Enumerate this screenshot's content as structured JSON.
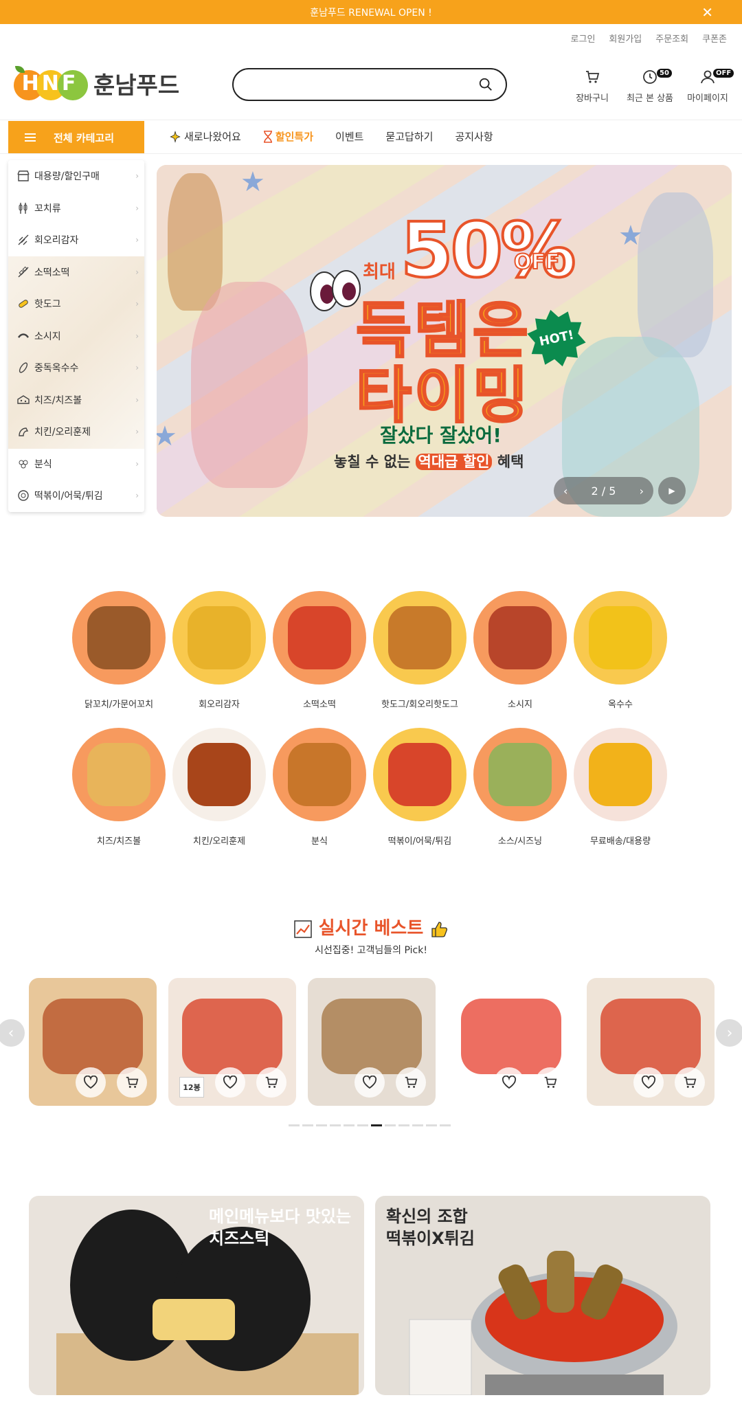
{
  "topbar": {
    "notice": "훈남푸드 RENEWAL OPEN !",
    "close": "✕"
  },
  "util": [
    "로그인",
    "회원가입",
    "주문조회",
    "쿠폰존"
  ],
  "logo": {
    "letters": "HNF",
    "brand": "훈남푸드"
  },
  "search": {
    "value": "",
    "placeholder": ""
  },
  "header_icons": [
    {
      "label": "장바구니",
      "icon": "cart-icon"
    },
    {
      "label": "최근 본 상품",
      "icon": "clock-icon",
      "badge": "50"
    },
    {
      "label": "마이페이지",
      "icon": "user-icon",
      "badge": "OFF"
    }
  ],
  "category_button": "전체 카테고리",
  "gnb": [
    "새로나왔어요",
    "할인특가",
    "이벤트",
    "묻고답하기",
    "공지사항"
  ],
  "category_menu": [
    "대용량/할인구매",
    "꼬치류",
    "회오리감자",
    "소떡소떡",
    "핫도그",
    "소시지",
    "중독옥수수",
    "치즈/치즈볼",
    "치킨/오리훈제",
    "분식",
    "떡볶이/어묵/튀김"
  ],
  "banner": {
    "max": "최대",
    "percent": "50%",
    "off": "OFF",
    "line1": "득템은",
    "line2": "타이밍",
    "hot": "HOT!",
    "sub1": "잘샀다 잘샀어!",
    "sub2_pre": "놓칠 수 없는",
    "sub2_mid": "역대급 할인",
    "sub2_post": "혜택",
    "page": "2 / 5"
  },
  "categories": [
    {
      "name": "닭꼬치/가문어꼬치",
      "bg": "#f79a5e",
      "food": "#9a5a2a"
    },
    {
      "name": "회오리감자",
      "bg": "#f9c94e",
      "food": "#e8b22a"
    },
    {
      "name": "소떡소떡",
      "bg": "#f79a5e",
      "food": "#d8452a"
    },
    {
      "name": "핫도그/회오리핫도그",
      "bg": "#f9c94e",
      "food": "#c87a2a"
    },
    {
      "name": "소시지",
      "bg": "#f79a5e",
      "food": "#b8452a"
    },
    {
      "name": "옥수수",
      "bg": "#f9c94e",
      "food": "#f2c21a"
    },
    {
      "name": "치즈/치즈볼",
      "bg": "#f79a5e",
      "food": "#e8b45a"
    },
    {
      "name": "치킨/오리훈제",
      "bg": "#f6efe8",
      "food": "#a8451a"
    },
    {
      "name": "분식",
      "bg": "#f79a5e",
      "food": "#c8762a"
    },
    {
      "name": "떡볶이/어묵/튀김",
      "bg": "#f9c94e",
      "food": "#d8452a"
    },
    {
      "name": "소스/시즈닝",
      "bg": "#f79a5e",
      "food": "#9ab05a"
    },
    {
      "name": "무료배송/대용량",
      "bg": "#f6e2da",
      "food": "#f2b21a"
    }
  ],
  "best": {
    "title": "실시간 베스트",
    "subtitle": "시선집중! 고객님들의 Pick!",
    "products": [
      {
        "bg": "#e8c79a",
        "food": "#b8552a"
      },
      {
        "bg": "#f2e6dc",
        "food": "#d8452a",
        "tag": "12봉"
      },
      {
        "bg": "#e6ddd3",
        "food": "#a87a4a"
      },
      {
        "bg": "#ffffff",
        "food": "#e84a3a"
      },
      {
        "bg": "#efe4d8",
        "food": "#d8452a"
      }
    ],
    "active_dot": 6,
    "dot_count": 12
  },
  "promos": [
    {
      "text1": "메인메뉴보다 맛있는",
      "text2": "치즈스틱",
      "color": "#ffffff",
      "bg": "#e9e3dc"
    },
    {
      "text1": "확신의 조합",
      "text2": "떡볶이Ⅹ튀김",
      "color": "#2a2a2a",
      "bg": "#e4dfd8"
    }
  ]
}
